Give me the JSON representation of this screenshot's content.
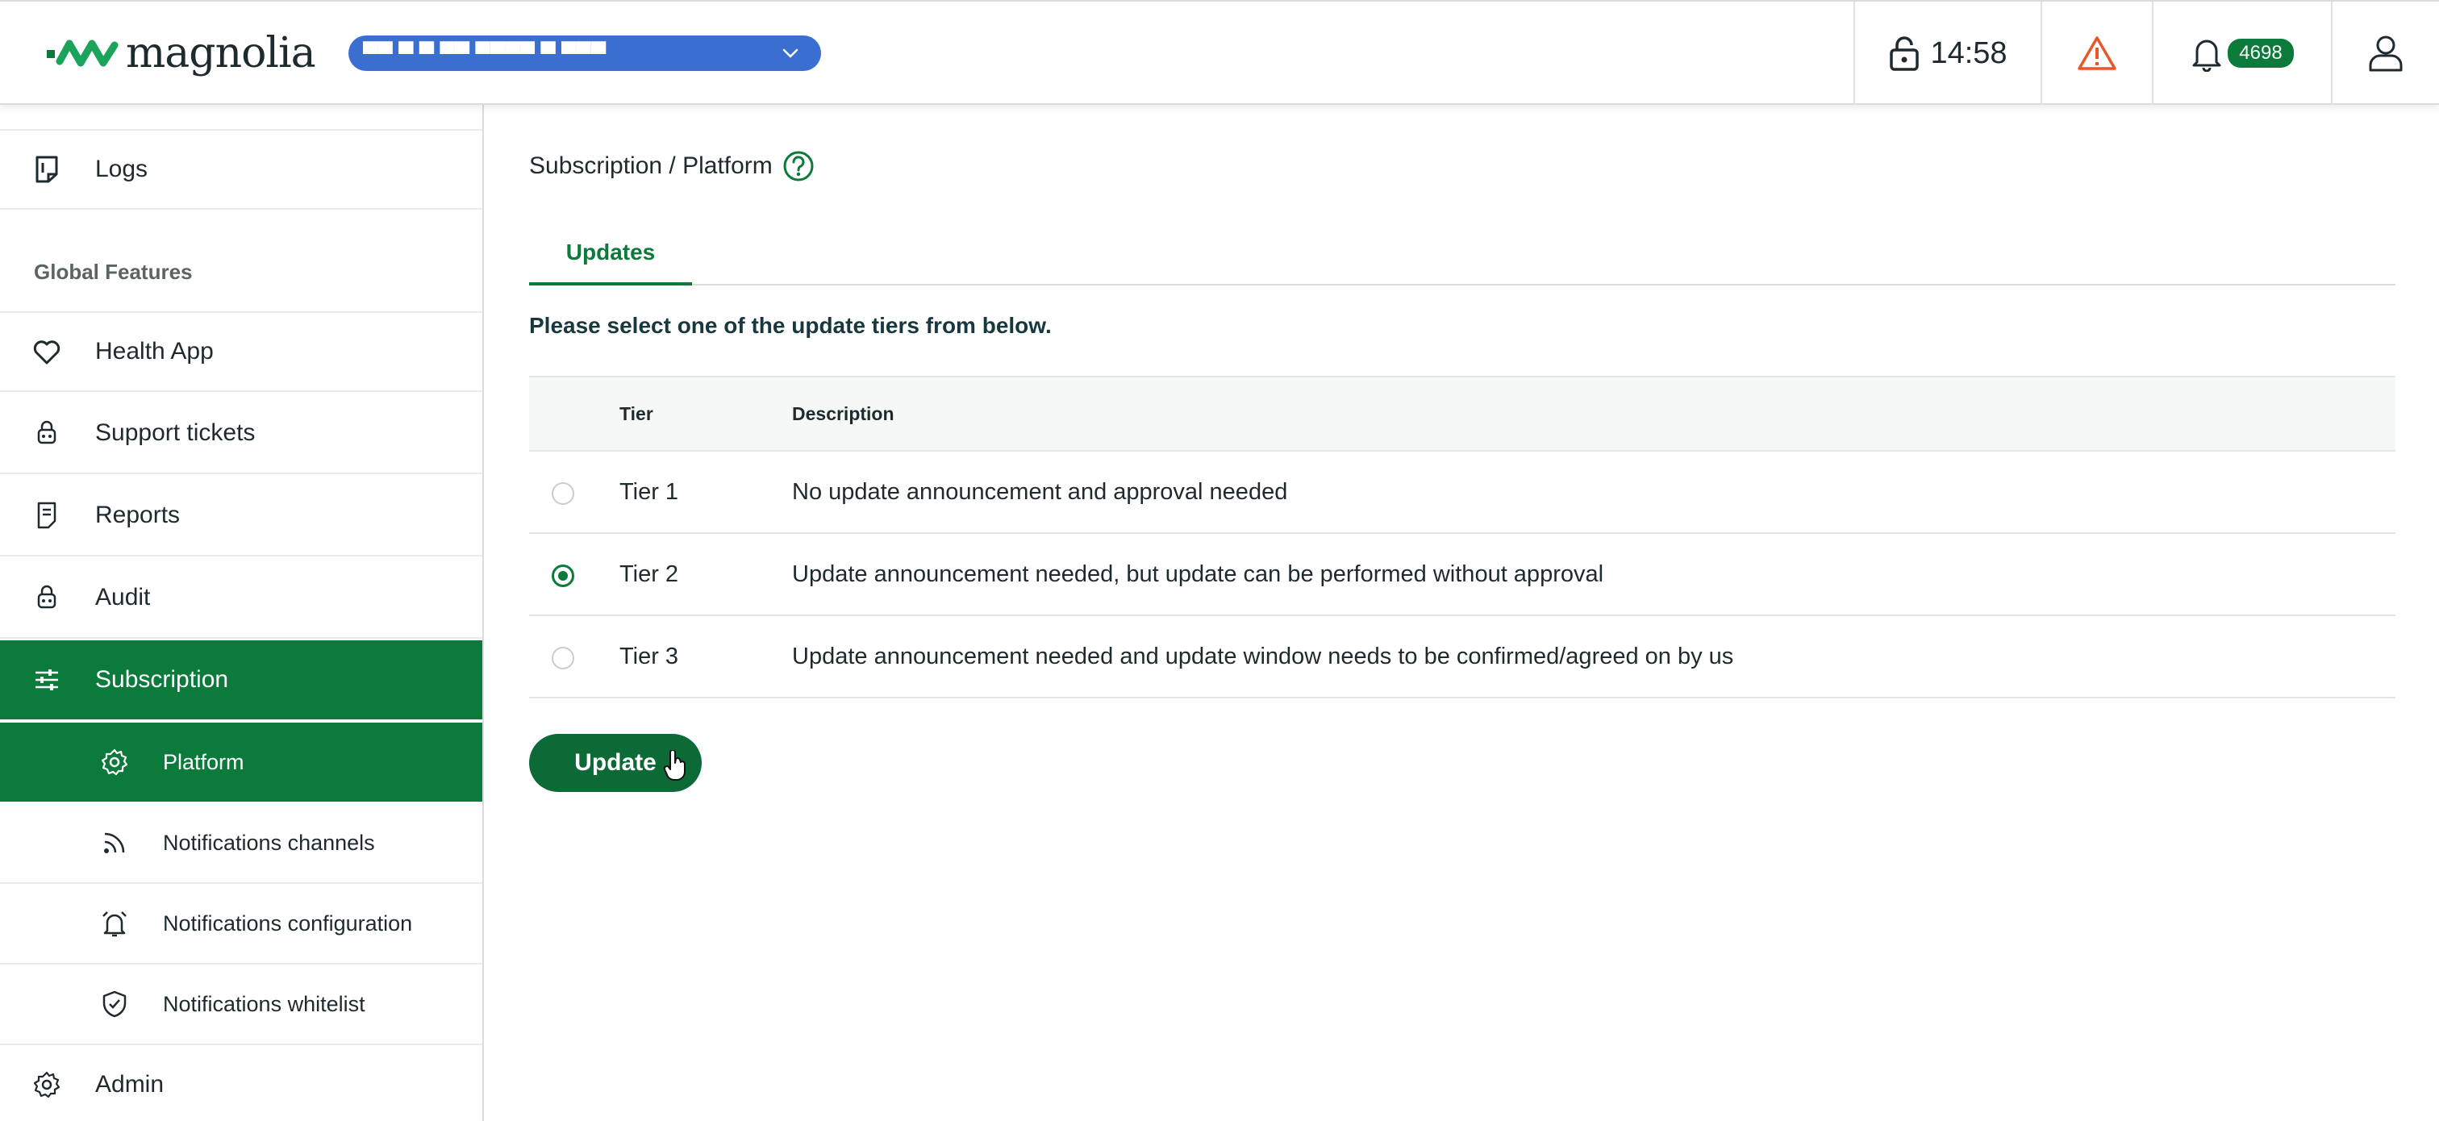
{
  "header": {
    "logo_text": "magnolia",
    "instance_name": "▀▀ ▀ ▀ ▀▀ ▀▀▀▀ ▀ ▀▀▀",
    "timer": "14:58",
    "notification_count": "4698"
  },
  "sidebar": {
    "items": [
      {
        "label": "Logs",
        "icon": "log-document-icon"
      },
      {
        "label": "Health App",
        "icon": "heart-icon"
      },
      {
        "label": "Support tickets",
        "icon": "support-icon"
      },
      {
        "label": "Reports",
        "icon": "report-document-icon"
      },
      {
        "label": "Audit",
        "icon": "audit-icon"
      },
      {
        "label": "Subscription",
        "icon": "sliders-icon"
      }
    ],
    "section_title": "Global Features",
    "subitems": [
      {
        "label": "Platform",
        "icon": "gear-icon"
      },
      {
        "label": "Notifications channels",
        "icon": "rss-icon"
      },
      {
        "label": "Notifications configuration",
        "icon": "alarm-bell-icon"
      },
      {
        "label": "Notifications whitelist",
        "icon": "shield-check-icon"
      }
    ],
    "admin": {
      "label": "Admin",
      "icon": "gear-icon"
    }
  },
  "main": {
    "breadcrumb": "Subscription / Platform",
    "tab": "Updates",
    "instruction": "Please select one of the update tiers from below.",
    "table": {
      "headers": {
        "tier": "Tier",
        "description": "Description"
      },
      "rows": [
        {
          "tier": "Tier 1",
          "description": "No update announcement and approval needed",
          "selected": false
        },
        {
          "tier": "Tier 2",
          "description": "Update announcement needed, but update can be performed without approval",
          "selected": true
        },
        {
          "tier": "Tier 3",
          "description": "Update announcement needed and update window needs to be confirmed/agreed on by us",
          "selected": false
        }
      ]
    },
    "update_button": "Update"
  },
  "colors": {
    "brand_green": "#0b7a3b",
    "selector_blue": "#3a6fd1",
    "warning_orange": "#e8572a"
  }
}
